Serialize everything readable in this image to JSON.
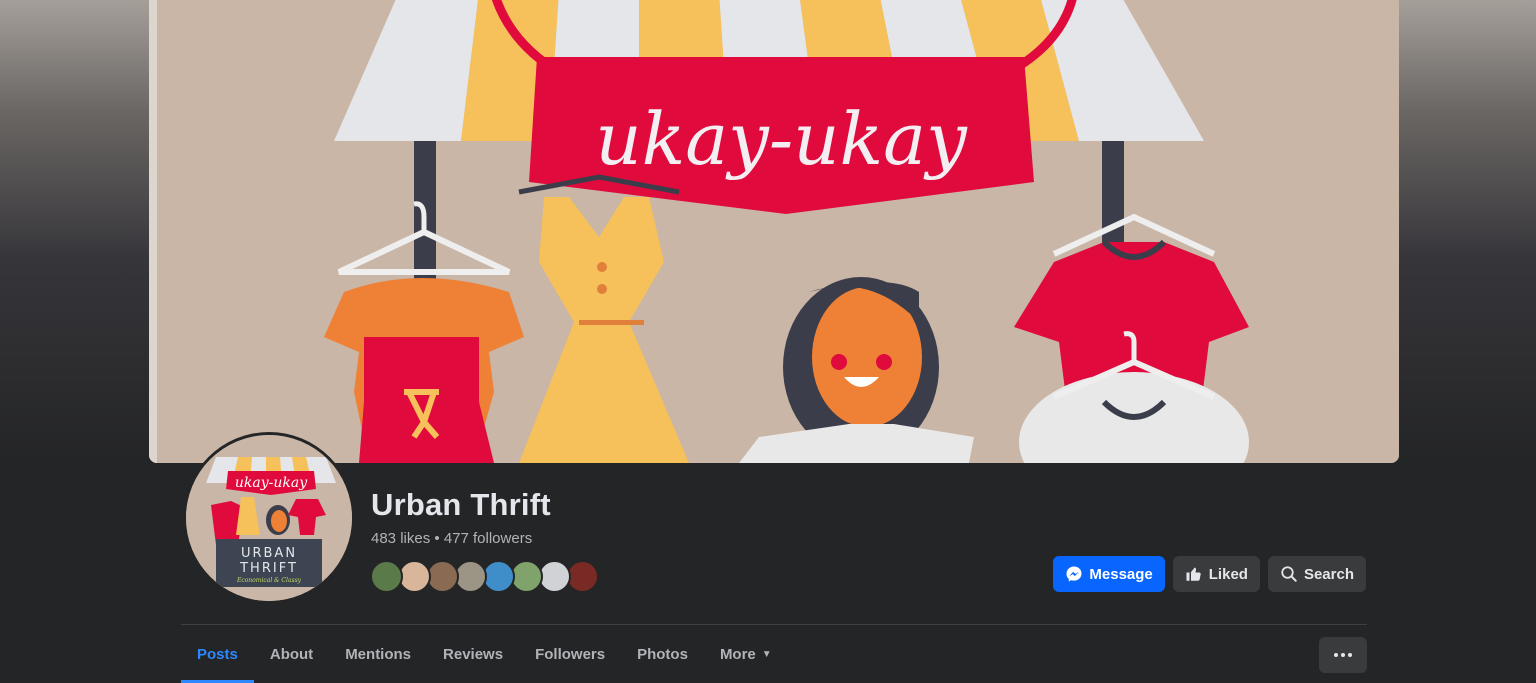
{
  "page": {
    "name": "Urban Thrift",
    "likes": "483 likes",
    "separator": "•",
    "followers": "477 followers"
  },
  "cover": {
    "banner_text": "ukay-ukay"
  },
  "profile_logo": {
    "banner_text": "ukay-ukay",
    "line1": "URBAN",
    "line2": "THRIFT",
    "tagline": "Economical & Classy"
  },
  "actions": {
    "message": "Message",
    "liked": "Liked",
    "search": "Search"
  },
  "tabs": [
    {
      "label": "Posts",
      "active": true
    },
    {
      "label": "About",
      "active": false
    },
    {
      "label": "Mentions",
      "active": false
    },
    {
      "label": "Reviews",
      "active": false
    },
    {
      "label": "Followers",
      "active": false
    },
    {
      "label": "Photos",
      "active": false
    },
    {
      "label": "More",
      "active": false
    }
  ],
  "friend_avatars": [
    {
      "name": "friend-avatar-1",
      "color": "#5b7a4a"
    },
    {
      "name": "friend-avatar-2",
      "color": "#d9b59a"
    },
    {
      "name": "friend-avatar-3",
      "color": "#8a6a52"
    },
    {
      "name": "friend-avatar-4",
      "color": "#9c9484"
    },
    {
      "name": "friend-avatar-5",
      "color": "#3f8ec9"
    },
    {
      "name": "friend-avatar-6",
      "color": "#7fa36a"
    },
    {
      "name": "friend-avatar-7",
      "color": "#d0d2d5"
    },
    {
      "name": "friend-avatar-8",
      "color": "#7a2a24"
    }
  ],
  "colors": {
    "accent": "#0866ff",
    "active_tab": "#2d88ff",
    "background": "#242526",
    "button_secondary": "#3a3b3c"
  }
}
